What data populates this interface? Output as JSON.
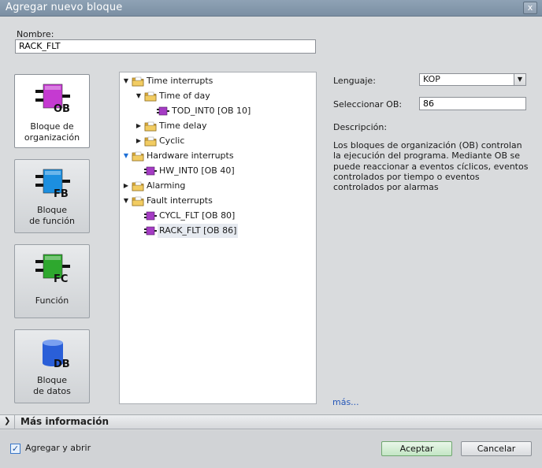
{
  "window": {
    "title": "Agregar nuevo bloque",
    "close_glyph": "x"
  },
  "name": {
    "label": "Nombre:",
    "value": "RACK_FLT"
  },
  "block_types": [
    {
      "icon": "ob-block-icon",
      "tag": "OB",
      "color": "#c53ad1",
      "line1": "Bloque de",
      "line2": "organización",
      "selected": true
    },
    {
      "icon": "fb-block-icon",
      "tag": "FB",
      "color": "#1c8fe0",
      "line1": "Bloque",
      "line2": "de función",
      "selected": false
    },
    {
      "icon": "fc-block-icon",
      "tag": "FC",
      "color": "#2ea82e",
      "line1": "Función",
      "line2": "",
      "selected": false
    },
    {
      "icon": "db-block-icon",
      "tag": "DB",
      "color": "#2a5fd8",
      "line1": "Bloque",
      "line2": "de datos",
      "selected": false
    }
  ],
  "tree": [
    {
      "label": "Time interrupts",
      "level": 0,
      "expander": "expanded",
      "icon": "folder-icon"
    },
    {
      "label": "Time of day",
      "level": 1,
      "expander": "expanded",
      "icon": "folder-icon"
    },
    {
      "label": "TOD_INT0 [OB 10]",
      "level": 2,
      "expander": "none",
      "icon": "ob-icon"
    },
    {
      "label": "Time delay",
      "level": 1,
      "expander": "collapsed",
      "icon": "folder-icon"
    },
    {
      "label": "Cyclic",
      "level": 1,
      "expander": "collapsed",
      "icon": "folder-icon"
    },
    {
      "label": "Hardware interrupts",
      "level": 0,
      "expander": "expanded-blue",
      "icon": "folder-icon"
    },
    {
      "label": "HW_INT0 [OB 40]",
      "level": 1,
      "expander": "none",
      "icon": "ob-icon"
    },
    {
      "label": "Alarming",
      "level": 0,
      "expander": "collapsed",
      "icon": "folder-icon"
    },
    {
      "label": "Fault interrupts",
      "level": 0,
      "expander": "expanded",
      "icon": "folder-icon"
    },
    {
      "label": "CYCL_FLT [OB 80]",
      "level": 1,
      "expander": "none",
      "icon": "ob-icon"
    },
    {
      "label": "RACK_FLT [OB 86]",
      "level": 1,
      "expander": "none",
      "icon": "ob-icon",
      "selected": true
    }
  ],
  "props": {
    "language_label": "Lenguaje:",
    "language_value": "KOP",
    "ob_label": "Seleccionar OB:",
    "ob_value": "86",
    "description_label": "Descripción:",
    "description": "Los bloques de organización (OB) controlan la ejecución del programa. Mediante OB se puede reaccionar a eventos cíclicos, eventos controlados por tiempo o eventos controlados por alarmas",
    "more_link": "más..."
  },
  "info_bar": {
    "label": "Más información"
  },
  "footer": {
    "checkbox_label": "Agregar y abrir",
    "checkbox_checked": true,
    "accept_label": "Aceptar",
    "cancel_label": "Cancelar"
  },
  "colors": {
    "folder": "#e3b23c",
    "ob_purple": "#a53cc4",
    "selection": "#e6eaf0"
  }
}
